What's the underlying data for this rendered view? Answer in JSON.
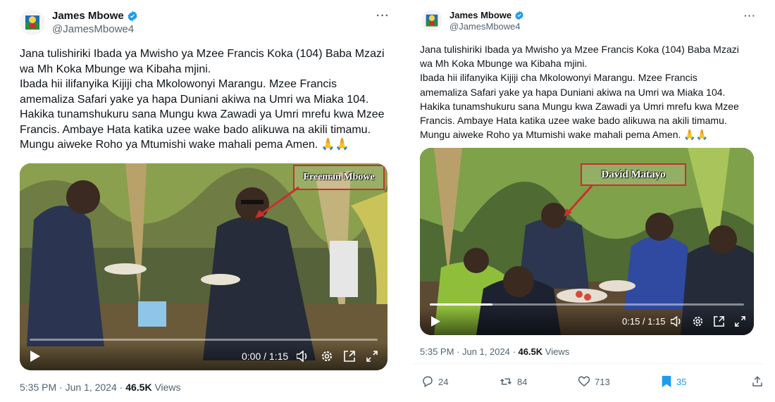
{
  "left": {
    "author": {
      "name": "James Mbowe",
      "handle": "@JamesMbowe4"
    },
    "text": "Jana tulishiriki Ibada ya Mwisho ya Mzee Francis Koka (104) Baba Mzazi\nwa Mh Koka Mbunge wa Kibaha mjini.\nIbada hii ilifanyika Kijiji cha Mkolowonyi Marangu. Mzee Francis\namemaliza Safari yake ya hapa Duniani akiwa na Umri wa Miaka 104.\nHakika tunamshukuru sana Mungu kwa Zawadi ya Umri mrefu kwa Mzee\nFrancis. Ambaye Hata katika uzee wake bado alikuwa na akili timamu.\nMungu aiweke Roho ya Mtumishi wake mahali pema Amen.",
    "emoji": "🙏🙏",
    "video": {
      "annotation": "Freeman Mbowe",
      "time": "0:00 / 1:15",
      "progress": 0.0
    },
    "meta": {
      "time": "5:35 PM · Jun 1, 2024 · ",
      "views_count": "46.5K",
      "views_label": " Views"
    }
  },
  "right": {
    "author": {
      "name": "James Mbowe",
      "handle": "@JamesMbowe4"
    },
    "text": "Jana tulishiriki Ibada ya Mwisho ya Mzee Francis Koka (104) Baba Mzazi\nwa Mh Koka Mbunge wa Kibaha mjini.\nIbada hii ilifanyika Kijiji cha Mkolowonyi Marangu. Mzee Francis\namemaliza Safari yake ya hapa Duniani akiwa na Umri wa Miaka 104.\nHakika tunamshukuru sana Mungu kwa Zawadi ya Umri mrefu kwa Mzee\nFrancis. Ambaye Hata katika uzee wake bado alikuwa na akili timamu.\nMungu aiweke Roho ya Mtumishi wake mahali pema Amen.",
    "emoji": "🙏🙏",
    "video": {
      "annotation": "David Matayo",
      "time": "0:15 / 1:15",
      "progress": 0.2
    },
    "meta": {
      "time": "5:35 PM · Jun 1, 2024 · ",
      "views_count": "46.5K",
      "views_label": " Views"
    },
    "actions": {
      "replies": "24",
      "reposts": "84",
      "likes": "713",
      "bookmarks": "35"
    }
  },
  "more_glyph": "···",
  "colors": {
    "verified": "#1d9bf0",
    "annotation_border": "#c9302c",
    "secondary_text": "#536471"
  }
}
